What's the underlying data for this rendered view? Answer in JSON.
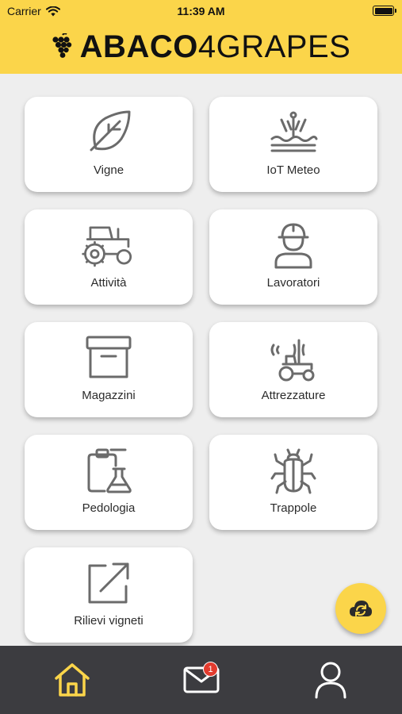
{
  "status": {
    "carrier": "Carrier",
    "time": "11:39 AM"
  },
  "brand": {
    "part1": "ABACO",
    "part2": "4GRAPES"
  },
  "tiles": [
    {
      "label": "Vigne",
      "icon": "leaf-icon"
    },
    {
      "label": "IoT Meteo",
      "icon": "iot-weather-icon"
    },
    {
      "label": "Attività",
      "icon": "tractor-icon"
    },
    {
      "label": "Lavoratori",
      "icon": "worker-icon"
    },
    {
      "label": "Magazzini",
      "icon": "warehouse-box-icon"
    },
    {
      "label": "Attrezzature",
      "icon": "equipment-icon"
    },
    {
      "label": "Pedologia",
      "icon": "soil-lab-icon"
    },
    {
      "label": "Trappole",
      "icon": "insect-icon"
    },
    {
      "label": "Rilievi vigneti",
      "icon": "external-link-icon"
    }
  ],
  "tabbar": {
    "items": [
      {
        "name": "home",
        "icon": "home-icon",
        "active": true
      },
      {
        "name": "messages",
        "icon": "mail-icon",
        "badge": "1"
      },
      {
        "name": "profile",
        "icon": "user-icon"
      }
    ]
  },
  "colors": {
    "accent": "#fbd54a",
    "tabbar": "#3c3c40",
    "icon": "#6b6b6b",
    "badge": "#e23b2e"
  }
}
